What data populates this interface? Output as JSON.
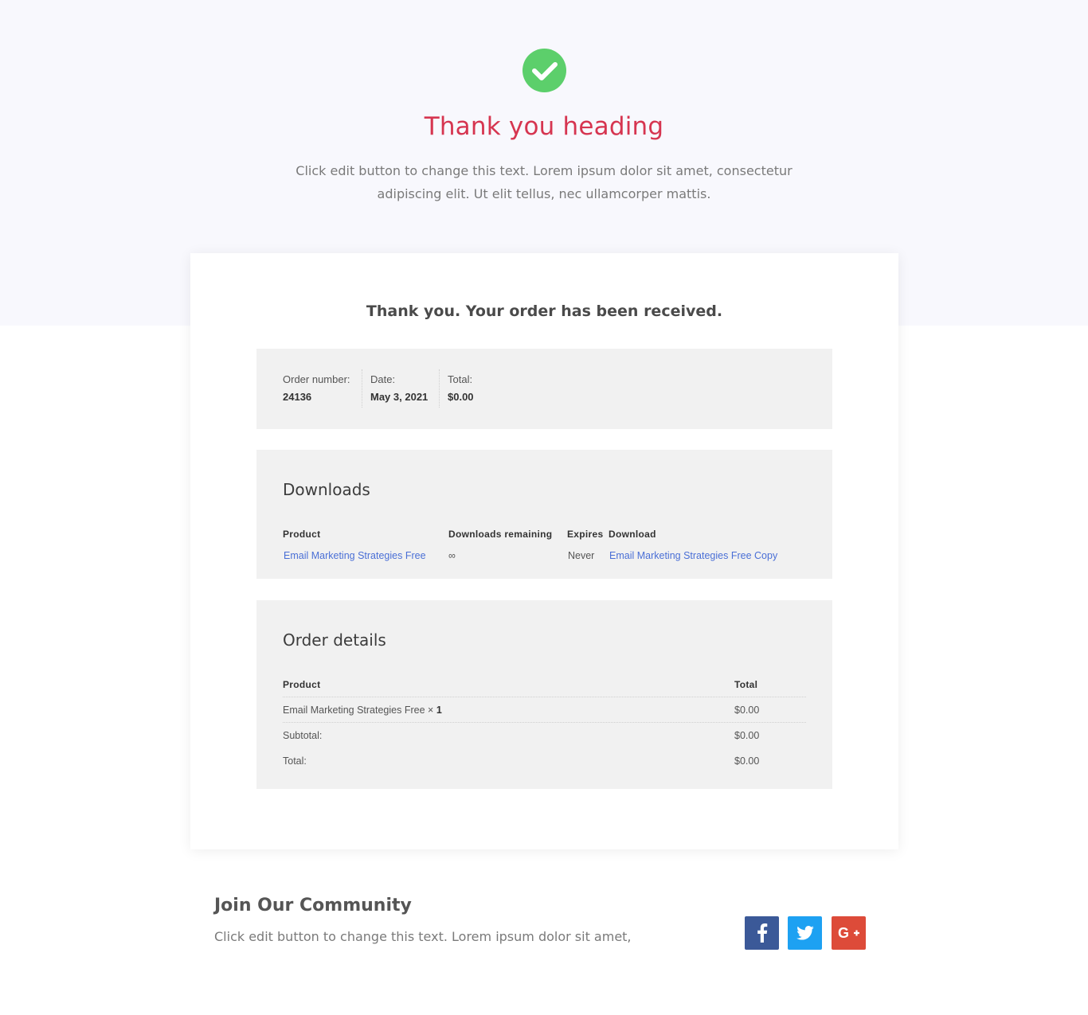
{
  "hero": {
    "title": "Thank you heading",
    "text_line1": "Click edit button to change this text. Lorem ipsum dolor sit amet, consectetur",
    "text_line2": "adipiscing elit. Ut elit tellus, nec ullamcorper mattis.",
    "icon": "check-circle-icon"
  },
  "order": {
    "received_title": "Thank you. Your order has been received.",
    "overview": {
      "number_label": "Order number:",
      "number_value": "24136",
      "date_label": "Date:",
      "date_value": "May 3, 2021",
      "total_label": "Total:",
      "total_value": "$0.00"
    },
    "downloads": {
      "heading": "Downloads",
      "columns": [
        "Product",
        "Downloads remaining",
        "Expires",
        "Download"
      ],
      "row": {
        "product": "Email Marketing Strategies Free",
        "remaining": "∞",
        "expires": "Never",
        "download": "Email Marketing Strategies Free Copy"
      }
    },
    "details": {
      "heading": "Order details",
      "col_product": "Product",
      "col_total": "Total",
      "item_name": "Email Marketing Strategies Free",
      "item_qty_sep": "×",
      "item_qty": "1",
      "item_total": "$0.00",
      "subtotal_label": "Subtotal:",
      "subtotal_value": "$0.00",
      "total_label": "Total:",
      "total_value": "$0.00"
    }
  },
  "community": {
    "title": "Join Our Community",
    "text": "Click edit button to change this text. Lorem ipsum dolor sit amet,"
  },
  "social": [
    {
      "icon": "facebook-icon",
      "color": "#3b5998"
    },
    {
      "icon": "twitter-icon",
      "color": "#1da1f2"
    },
    {
      "icon": "google-plus-icon",
      "color": "#dd4b39"
    }
  ],
  "colors": {
    "accent_heading": "#d63550",
    "success_green": "#5ccf6b",
    "link_blue": "#4a6fd6",
    "hero_bg": "#f8f8fd",
    "panel_bg": "#f1f1f1"
  }
}
